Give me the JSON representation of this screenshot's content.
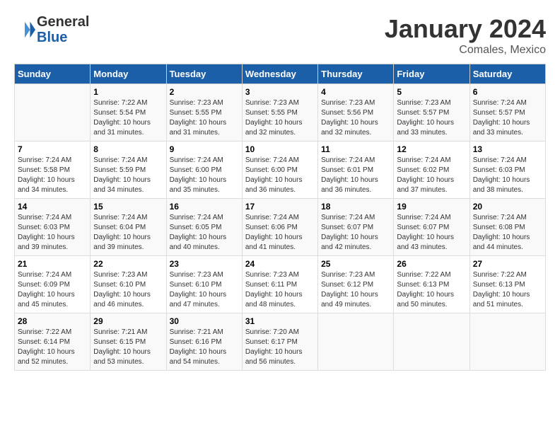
{
  "header": {
    "logo_text_general": "General",
    "logo_text_blue": "Blue",
    "month_title": "January 2024",
    "location": "Comales, Mexico"
  },
  "days_of_week": [
    "Sunday",
    "Monday",
    "Tuesday",
    "Wednesday",
    "Thursday",
    "Friday",
    "Saturday"
  ],
  "weeks": [
    [
      {
        "day": "",
        "sunrise": "",
        "sunset": "",
        "daylight": ""
      },
      {
        "day": "1",
        "sunrise": "7:22 AM",
        "sunset": "5:54 PM",
        "daylight": "10 hours and 31 minutes."
      },
      {
        "day": "2",
        "sunrise": "7:23 AM",
        "sunset": "5:55 PM",
        "daylight": "10 hours and 31 minutes."
      },
      {
        "day": "3",
        "sunrise": "7:23 AM",
        "sunset": "5:55 PM",
        "daylight": "10 hours and 32 minutes."
      },
      {
        "day": "4",
        "sunrise": "7:23 AM",
        "sunset": "5:56 PM",
        "daylight": "10 hours and 32 minutes."
      },
      {
        "day": "5",
        "sunrise": "7:23 AM",
        "sunset": "5:57 PM",
        "daylight": "10 hours and 33 minutes."
      },
      {
        "day": "6",
        "sunrise": "7:24 AM",
        "sunset": "5:57 PM",
        "daylight": "10 hours and 33 minutes."
      }
    ],
    [
      {
        "day": "7",
        "sunrise": "7:24 AM",
        "sunset": "5:58 PM",
        "daylight": "10 hours and 34 minutes."
      },
      {
        "day": "8",
        "sunrise": "7:24 AM",
        "sunset": "5:59 PM",
        "daylight": "10 hours and 34 minutes."
      },
      {
        "day": "9",
        "sunrise": "7:24 AM",
        "sunset": "6:00 PM",
        "daylight": "10 hours and 35 minutes."
      },
      {
        "day": "10",
        "sunrise": "7:24 AM",
        "sunset": "6:00 PM",
        "daylight": "10 hours and 36 minutes."
      },
      {
        "day": "11",
        "sunrise": "7:24 AM",
        "sunset": "6:01 PM",
        "daylight": "10 hours and 36 minutes."
      },
      {
        "day": "12",
        "sunrise": "7:24 AM",
        "sunset": "6:02 PM",
        "daylight": "10 hours and 37 minutes."
      },
      {
        "day": "13",
        "sunrise": "7:24 AM",
        "sunset": "6:03 PM",
        "daylight": "10 hours and 38 minutes."
      }
    ],
    [
      {
        "day": "14",
        "sunrise": "7:24 AM",
        "sunset": "6:03 PM",
        "daylight": "10 hours and 39 minutes."
      },
      {
        "day": "15",
        "sunrise": "7:24 AM",
        "sunset": "6:04 PM",
        "daylight": "10 hours and 39 minutes."
      },
      {
        "day": "16",
        "sunrise": "7:24 AM",
        "sunset": "6:05 PM",
        "daylight": "10 hours and 40 minutes."
      },
      {
        "day": "17",
        "sunrise": "7:24 AM",
        "sunset": "6:06 PM",
        "daylight": "10 hours and 41 minutes."
      },
      {
        "day": "18",
        "sunrise": "7:24 AM",
        "sunset": "6:07 PM",
        "daylight": "10 hours and 42 minutes."
      },
      {
        "day": "19",
        "sunrise": "7:24 AM",
        "sunset": "6:07 PM",
        "daylight": "10 hours and 43 minutes."
      },
      {
        "day": "20",
        "sunrise": "7:24 AM",
        "sunset": "6:08 PM",
        "daylight": "10 hours and 44 minutes."
      }
    ],
    [
      {
        "day": "21",
        "sunrise": "7:24 AM",
        "sunset": "6:09 PM",
        "daylight": "10 hours and 45 minutes."
      },
      {
        "day": "22",
        "sunrise": "7:23 AM",
        "sunset": "6:10 PM",
        "daylight": "10 hours and 46 minutes."
      },
      {
        "day": "23",
        "sunrise": "7:23 AM",
        "sunset": "6:10 PM",
        "daylight": "10 hours and 47 minutes."
      },
      {
        "day": "24",
        "sunrise": "7:23 AM",
        "sunset": "6:11 PM",
        "daylight": "10 hours and 48 minutes."
      },
      {
        "day": "25",
        "sunrise": "7:23 AM",
        "sunset": "6:12 PM",
        "daylight": "10 hours and 49 minutes."
      },
      {
        "day": "26",
        "sunrise": "7:22 AM",
        "sunset": "6:13 PM",
        "daylight": "10 hours and 50 minutes."
      },
      {
        "day": "27",
        "sunrise": "7:22 AM",
        "sunset": "6:13 PM",
        "daylight": "10 hours and 51 minutes."
      }
    ],
    [
      {
        "day": "28",
        "sunrise": "7:22 AM",
        "sunset": "6:14 PM",
        "daylight": "10 hours and 52 minutes."
      },
      {
        "day": "29",
        "sunrise": "7:21 AM",
        "sunset": "6:15 PM",
        "daylight": "10 hours and 53 minutes."
      },
      {
        "day": "30",
        "sunrise": "7:21 AM",
        "sunset": "6:16 PM",
        "daylight": "10 hours and 54 minutes."
      },
      {
        "day": "31",
        "sunrise": "7:20 AM",
        "sunset": "6:17 PM",
        "daylight": "10 hours and 56 minutes."
      },
      {
        "day": "",
        "sunrise": "",
        "sunset": "",
        "daylight": ""
      },
      {
        "day": "",
        "sunrise": "",
        "sunset": "",
        "daylight": ""
      },
      {
        "day": "",
        "sunrise": "",
        "sunset": "",
        "daylight": ""
      }
    ]
  ]
}
